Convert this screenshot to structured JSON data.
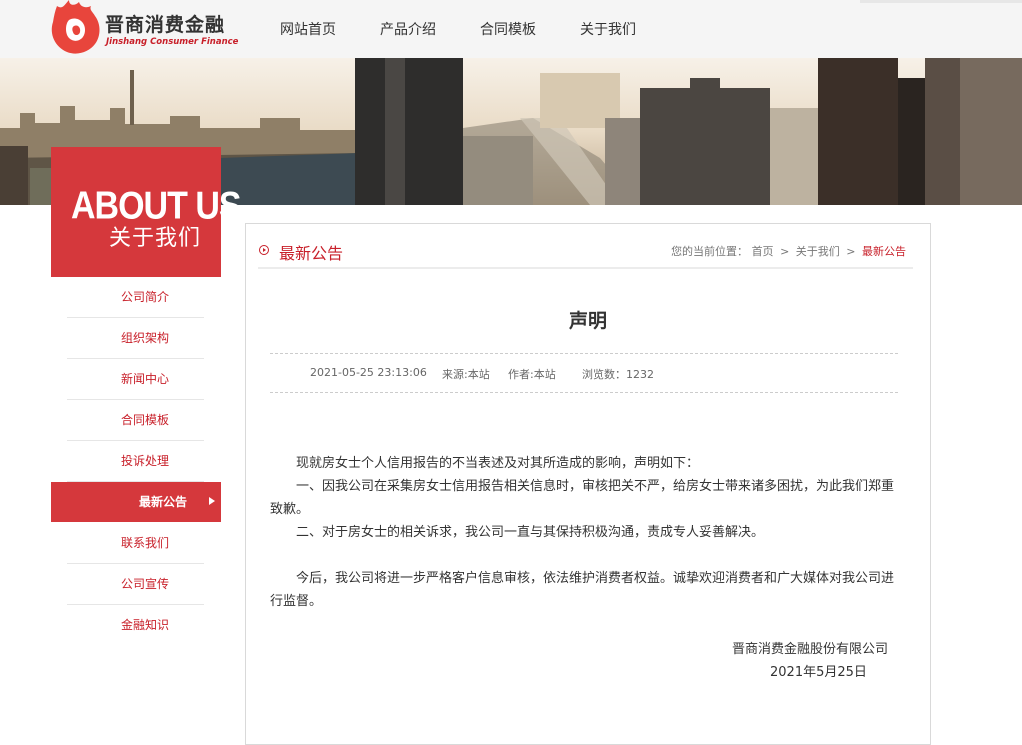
{
  "header": {
    "logo_cn": "晋商消费金融",
    "logo_en": "Jinshang Consumer Finance",
    "nav": [
      "网站首页",
      "产品介绍",
      "合同模板",
      "关于我们"
    ],
    "brand_color": "#c8202a"
  },
  "sidebar": {
    "title_en": "ABOUT US",
    "title_cn": "关于我们",
    "items": [
      {
        "label": "公司简介",
        "active": false
      },
      {
        "label": "组织架构",
        "active": false
      },
      {
        "label": "新闻中心",
        "active": false
      },
      {
        "label": "合同模板",
        "active": false
      },
      {
        "label": "投诉处理",
        "active": false
      },
      {
        "label": "最新公告",
        "active": true
      },
      {
        "label": "联系我们",
        "active": false
      },
      {
        "label": "公司宣传",
        "active": false
      },
      {
        "label": "金融知识",
        "active": false
      }
    ],
    "active_color": "#d5383c"
  },
  "panel": {
    "section_title": "最新公告",
    "breadcrumb": {
      "prefix": "您的当前位置：",
      "items": [
        "首页",
        "关于我们",
        "最新公告"
      ],
      "separator": ">"
    }
  },
  "article": {
    "title": "声明",
    "date": "2021-05-25 23:13:06",
    "source": "来源:本站",
    "author": "作者:本站",
    "views": "浏览数：1232",
    "para1": "现就房女士个人信用报告的不当表述及对其所造成的影响，声明如下：",
    "para2": "一、因我公司在采集房女士信用报告相关信息时，审核把关不严，给房女士带来诸多困扰，为此我们郑重致歉。",
    "para3": "二、对于房女士的相关诉求，我公司一直与其保持积极沟通，责成专人妥善解决。",
    "para4": "今后，我公司将进一步严格客户信息审核，依法维护消费者权益。诚挚欢迎消费者和广大媒体对我公司进行监督。",
    "signature": "晋商消费金融股份有限公司",
    "sign_date": "2021年5月25日"
  }
}
